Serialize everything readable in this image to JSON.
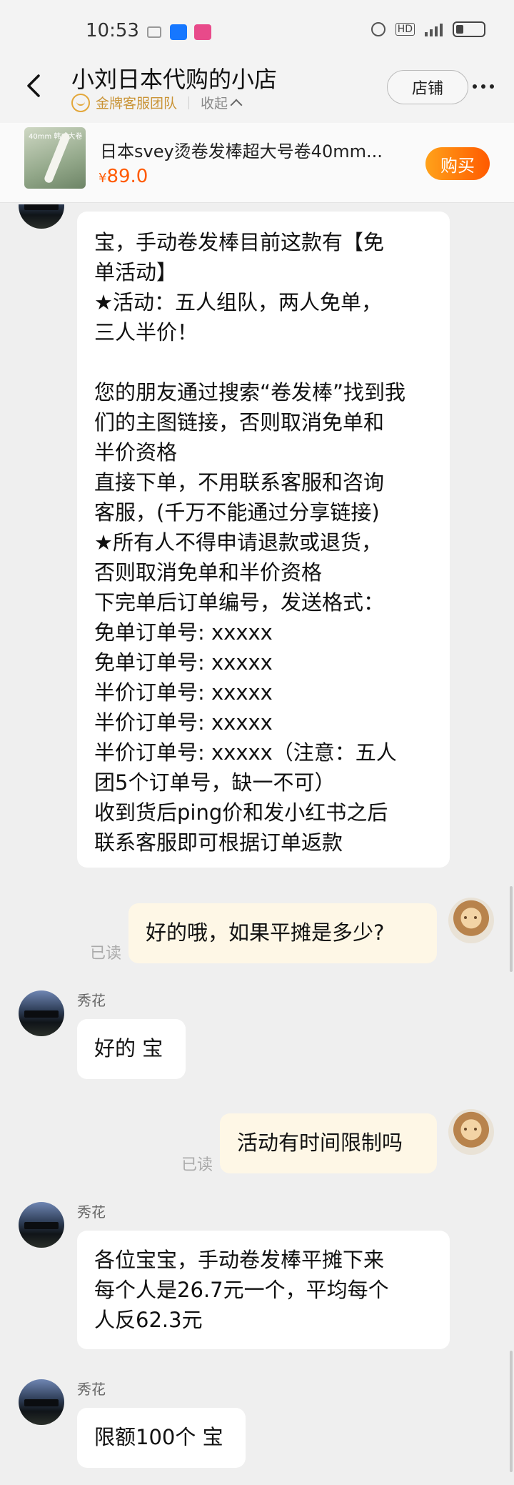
{
  "status_bar": {
    "time": "10:53",
    "icons": [
      "nfc-icon",
      "alipay-icon",
      "app-icon"
    ],
    "colors": {
      "alipay": "#1677ff",
      "app": "#e84a8a"
    }
  },
  "header": {
    "title": "小刘日本代购的小店",
    "service_badge": "金牌客服团队",
    "collapse_label": "收起",
    "store_button": "店铺"
  },
  "product": {
    "title": "日本svey烫卷发棒超大号卷40mm...",
    "currency": "¥",
    "price": "89.0",
    "buy_button": "购买",
    "thumb_label": "40mm 韩式大卷"
  },
  "messages": [
    {
      "from": "seller",
      "text": "宝，手动卷发棒目前这款有【免\n单活动】\n★活动：五人组队，两人免单，\n三人半价！\n\n您的朋友通过搜索“卷发棒”找到我\n们的主图链接，否则取消免单和\n半价资格\n直接下单，不用联系客服和咨询\n客服，(千万不能通过分享链接)\n★所有人不得申请退款或退货，\n否则取消免单和半价资格\n下完单后订单编号，发送格式：\n免单订单号: xxxxx\n免单订单号: xxxxx\n半价订单号: xxxxx\n半价订单号: xxxxx\n半价订单号: xxxxx（注意：五人\n团5个订单号，缺一不可）\n收到货后ping价和发小红书之后\n联系客服即可根据订单返款"
    },
    {
      "from": "me",
      "text": "好的哦，如果平摊是多少?",
      "status": "已读"
    },
    {
      "from": "seller",
      "sender": "秀花",
      "text": "好的 宝"
    },
    {
      "from": "me",
      "text": "活动有时间限制吗",
      "status": "已读"
    },
    {
      "from": "seller",
      "sender": "秀花",
      "text": "各位宝宝，手动卷发棒平摊下来\n每个人是26.7元一个，平均每个\n人反62.3元"
    },
    {
      "from": "seller",
      "sender": "秀花",
      "text": "限额100个 宝"
    }
  ],
  "colors": {
    "accent_orange": "#ff5a00",
    "gold": "#c99335",
    "outgoing_bubble": "#fef7e6",
    "incoming_bubble": "#ffffff",
    "background": "#efefef"
  }
}
